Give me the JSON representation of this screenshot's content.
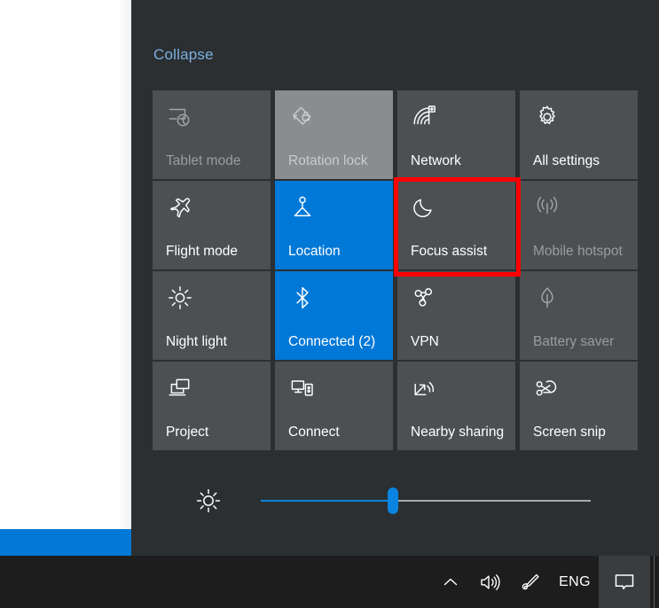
{
  "action_center": {
    "collapse_label": "Collapse",
    "tiles": [
      {
        "label": "Tablet mode",
        "icon": "tablet-mode-icon",
        "state": "disabled"
      },
      {
        "label": "Rotation lock",
        "icon": "rotation-lock-icon",
        "state": "disabled-hover"
      },
      {
        "label": "Network",
        "icon": "network-wifi-icon",
        "state": "normal"
      },
      {
        "label": "All settings",
        "icon": "gear-icon",
        "state": "normal"
      },
      {
        "label": "Flight mode",
        "icon": "airplane-icon",
        "state": "normal"
      },
      {
        "label": "Location",
        "icon": "location-icon",
        "state": "active"
      },
      {
        "label": "Focus assist",
        "icon": "moon-icon",
        "state": "normal"
      },
      {
        "label": "Mobile hotspot",
        "icon": "hotspot-icon",
        "state": "disabled"
      },
      {
        "label": "Night light",
        "icon": "sun-icon",
        "state": "normal"
      },
      {
        "label": "Connected (2)",
        "icon": "bluetooth-icon",
        "state": "active"
      },
      {
        "label": "VPN",
        "icon": "vpn-icon",
        "state": "normal"
      },
      {
        "label": "Battery saver",
        "icon": "leaf-icon",
        "state": "disabled"
      },
      {
        "label": "Project",
        "icon": "project-icon",
        "state": "normal"
      },
      {
        "label": "Connect",
        "icon": "connect-icon",
        "state": "normal"
      },
      {
        "label": "Nearby sharing",
        "icon": "nearby-share-icon",
        "state": "normal"
      },
      {
        "label": "Screen snip",
        "icon": "screen-snip-icon",
        "state": "normal"
      }
    ],
    "brightness": {
      "icon": "brightness-sun-icon",
      "value_percent": 40
    },
    "highlight": {
      "target_label": "Focus assist",
      "color": "#ff0000"
    }
  },
  "taskbar": {
    "tray": {
      "chevron_icon": "chevron-up-icon",
      "volume_icon": "speaker-icon",
      "pen_icon": "pen-workspace-icon",
      "language_label": "ENG",
      "notification_icon": "notification-balloon-icon"
    }
  },
  "colors": {
    "panel_bg": "#2f3337",
    "tile_bg": "#4c5053",
    "tile_active": "#0078d7",
    "tile_hover": "#8a8d8f",
    "accent_blue": "#0078d4",
    "link_blue": "#7cb0de",
    "highlight_red": "#ff0000",
    "taskbar_bg": "#1d1d1d"
  }
}
